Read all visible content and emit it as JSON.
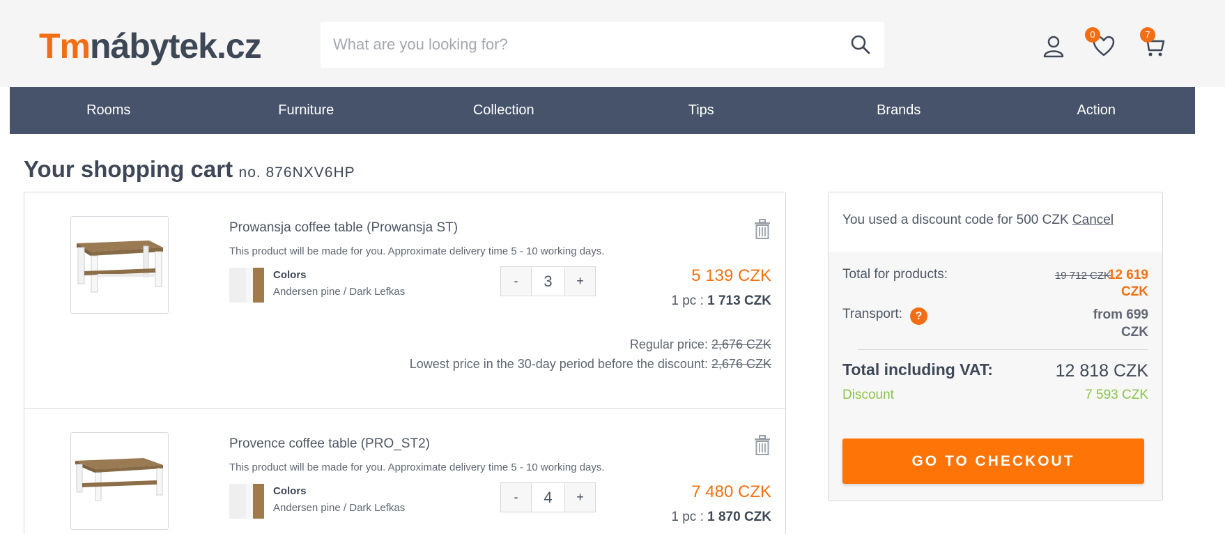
{
  "header": {
    "logo_tm": "Tm",
    "logo_rest": "nábytek.cz",
    "search_placeholder": "What are you looking for?",
    "wishlist_count": "0",
    "cart_count": "7"
  },
  "nav": [
    "Rooms",
    "Furniture",
    "Collection",
    "Tips",
    "Brands",
    "Action"
  ],
  "cart": {
    "title": "Your shopping cart",
    "number": "no. 876NXV6HP"
  },
  "items": [
    {
      "name": "Prowansja coffee table (Prowansja ST)",
      "note": "This product will be made for you. Approximate delivery time 5 - 10 working days.",
      "color_label": "Colors",
      "color_value": "Andersen pine / Dark Lefkas",
      "qty": "3",
      "minus": "-",
      "plus": "+",
      "price": "5 139 CZK",
      "unit_prefix": "1 pc : ",
      "unit_price": "1 713 CZK",
      "regular_label": "Regular price: ",
      "regular_value": "2,676 CZK",
      "lowest_label": "Lowest price in the 30-day period before the discount: ",
      "lowest_value": "2,676 CZK"
    },
    {
      "name": "Provence coffee table (PRO_ST2)",
      "note": "This product will be made for you. Approximate delivery time 5 - 10 working days.",
      "color_label": "Colors",
      "color_value": "Andersen pine / Dark Lefkas",
      "qty": "4",
      "minus": "-",
      "plus": "+",
      "price": "7 480 CZK",
      "unit_prefix": "1 pc : ",
      "unit_price": "1 870 CZK"
    }
  ],
  "summary": {
    "discount_text": "You used a discount code for 500 CZK",
    "cancel": "Cancel",
    "total_products_label": "Total for products:",
    "total_products_old": "19 712 CZK",
    "total_products_new": "12 619 CZK",
    "transport_label": "Transport:",
    "transport_help": "?",
    "transport_value": "from 699 CZK",
    "total_vat_label": "Total including VAT:",
    "total_vat_value": "12 818 CZK",
    "discount_label": "Discount",
    "discount_value": "7 593 CZK",
    "checkout": "GO TO CHECKOUT"
  },
  "colors": {
    "accent": "#f26d14",
    "nav_bg": "#46536a",
    "discount_green": "#8bc34a"
  }
}
